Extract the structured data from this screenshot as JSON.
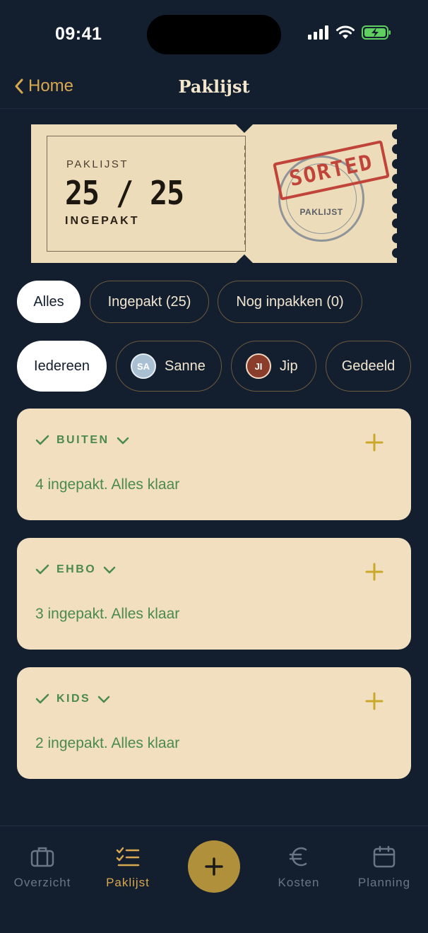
{
  "status_bar": {
    "time": "09:41"
  },
  "nav": {
    "back_label": "Home",
    "title": "Paklijst"
  },
  "ticket": {
    "label": "PAKLIJST",
    "count": "25 / 25",
    "subtitle": "INGEPAKT",
    "stamp_word": "SORTED",
    "stamp_caption": "PAKLIJST"
  },
  "status_filters": [
    {
      "label": "Alles",
      "active": true
    },
    {
      "label": "Ingepakt (25)",
      "active": false
    },
    {
      "label": "Nog inpakken (0)",
      "active": false
    }
  ],
  "people_filters": [
    {
      "label": "Iedereen",
      "active": true
    },
    {
      "label": "Sanne",
      "initials": "SA",
      "active": false
    },
    {
      "label": "Jip",
      "initials": "JI",
      "active": false
    },
    {
      "label": "Gedeeld",
      "active": false
    }
  ],
  "categories": [
    {
      "title": "BUITEN",
      "status": "4 ingepakt. Alles klaar"
    },
    {
      "title": "EHBO",
      "status": "3 ingepakt. Alles klaar"
    },
    {
      "title": "KIDS",
      "status": "2 ingepakt. Alles klaar"
    }
  ],
  "tabs": [
    {
      "label": "Overzicht",
      "icon": "suitcase-icon",
      "active": false
    },
    {
      "label": "Paklijst",
      "icon": "checklist-icon",
      "active": true
    },
    {
      "label": "Kosten",
      "icon": "euro-icon",
      "active": false
    },
    {
      "label": "Planning",
      "icon": "calendar-icon",
      "active": false
    }
  ],
  "colors": {
    "background": "#131e2e",
    "accent": "#d8a850",
    "card": "#f2dfc0",
    "success": "#4a8a4c",
    "stamp_red": "#c0443a",
    "fab": "#b0903a"
  }
}
